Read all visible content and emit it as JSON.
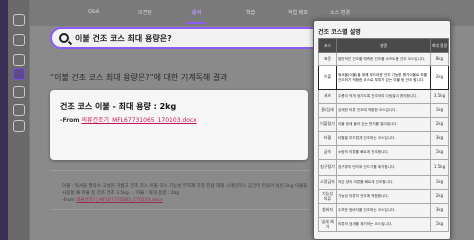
{
  "tabs": [
    {
      "label": "Q&A"
    },
    {
      "label": "의견란"
    },
    {
      "label": "문서",
      "active": true
    },
    {
      "label": "학습"
    },
    {
      "label": "작업 배포"
    },
    {
      "label": "소스 변경"
    }
  ],
  "search": {
    "query": "이불 건조 코스 최대 용량은?"
  },
  "result": {
    "title": "“이불 건조 코스 최대 용량은?”에 대한 기계독해 결과",
    "answer": "건조 코스 이불 - 최대 용량 : 2kg",
    "from_label": "-From",
    "from_file": "의류건조기_MFL67731065_170103.docx"
  },
  "excerpt": {
    "text": "이불 : 워셔블 팔라쓰 구성된 가볍고 건조 코스 이불 코스 기능성 부자재 가정 전용 대형 스테인리스 공간이 만들어 실린 2kg 이불을 사용할 때 이불 등 건조 건조 3.5kg ... 이불 : 최대 용량 : 2kg",
    "from_label": "-From",
    "from_file": "의류건조기_MFL67731065_170103.docx"
  },
  "panel": {
    "title": "건조 코스별 설명",
    "headers": [
      "코스",
      "설명",
      "최대 용량"
    ],
    "rows": [
      {
        "name": "표준",
        "desc": "일반적인 건조를 예측한 건조를 소프트용 건조 코스입니다.",
        "cap": "8kg"
      },
      {
        "name": "이불",
        "desc": "워셔블(이불)을 위해 부드러운 건조 기능한 평가이불로 보를 건조하기 적합한 코스로 부피가 있는 이불 등 건조 합니다.",
        "cap": "2kg",
        "highlight": true
      },
      {
        "name": "셔츠",
        "desc": "주름이 적게 생기도록 건조하여 다림질이 편리합니다.",
        "cap": "3.5kg"
      },
      {
        "name": "울/섬세",
        "desc": "섬세한 의류 건조에 적합한 코스입니다.",
        "cap": "1kg"
      },
      {
        "name": "이불털기",
        "desc": "이불 등에 붙어 있는 먼지를 털어냅니다.",
        "cap": "2kg"
      },
      {
        "name": "타월",
        "desc": "타월을 부드럽게 건조하는 코스입니다.",
        "cap": "3kg"
      },
      {
        "name": "급속",
        "desc": "소량의 의류를 빠르게 건조합니다.",
        "cap": "1kg"
      },
      {
        "name": "침구털기",
        "desc": "침구류의 먼지와 진드기를 제거합니다.",
        "cap": "1.5kg"
      },
      {
        "name": "소량급속",
        "desc": "적은 양의 의류를 빠르게 건조합니다.",
        "cap": "1kg"
      },
      {
        "name": "기능성 의류",
        "desc": "기능성 의류의 건조에 적합합니다.",
        "cap": "2kg"
      },
      {
        "name": "청바지",
        "desc": "두꺼운 청바지를 건조하는 코스입니다.",
        "cap": "3kg"
      },
      {
        "name": "냄새 제거",
        "desc": "의류의 냄새를 제거하는 코스입니다.",
        "cap": "1kg"
      }
    ]
  }
}
